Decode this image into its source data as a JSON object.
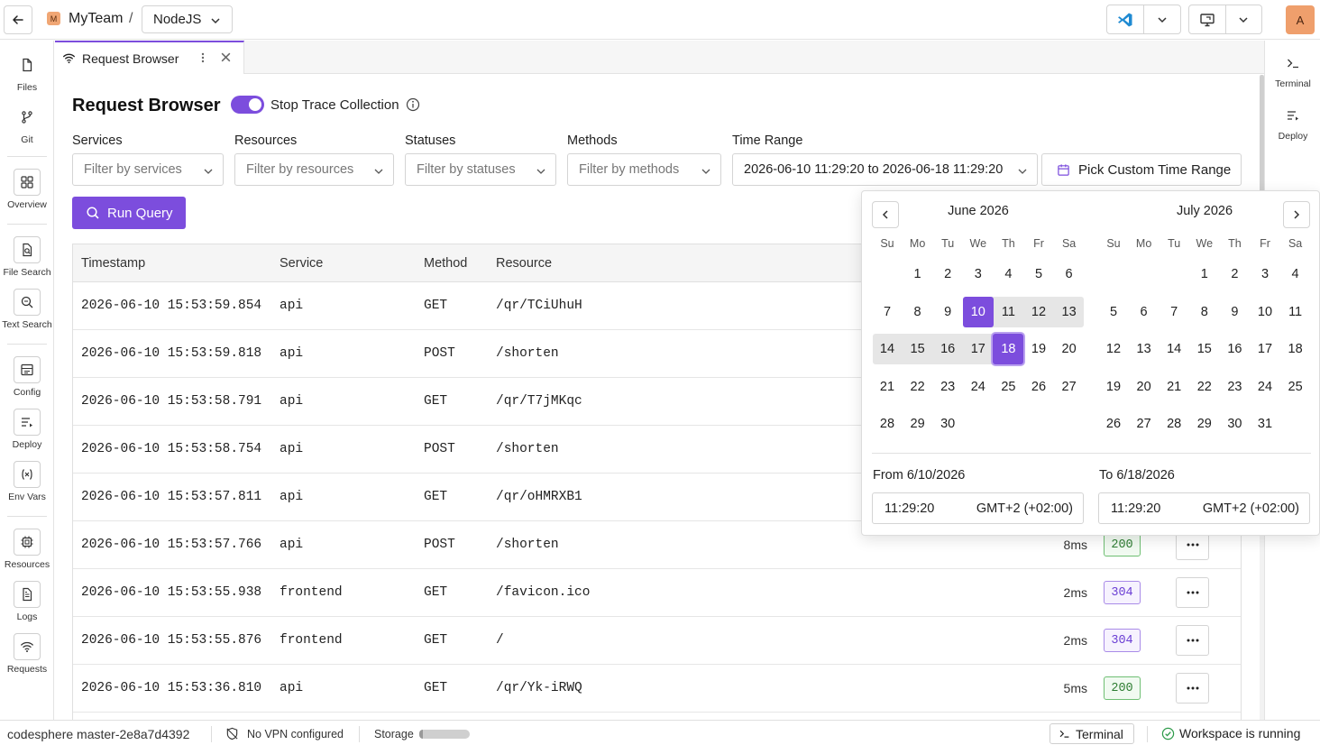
{
  "header": {
    "team_logo": "M",
    "team_name": "MyTeam",
    "separator": "/",
    "workspace": "NodeJS",
    "avatar": "A"
  },
  "sidebar": {
    "files": "Files",
    "git": "Git",
    "overview": "Overview",
    "file_search": "File Search",
    "text_search": "Text Search",
    "config": "Config",
    "deploy": "Deploy",
    "env_vars": "Env Vars",
    "resources": "Resources",
    "logs": "Logs",
    "requests": "Requests"
  },
  "right_sidebar": {
    "terminal": "Terminal",
    "deploy": "Deploy"
  },
  "tab": {
    "title": "Request Browser"
  },
  "page": {
    "title": "Request Browser",
    "toggle_label": "Stop Trace Collection",
    "toggle_on": true
  },
  "filters": {
    "services_label": "Services",
    "services_placeholder": "Filter by services",
    "resources_label": "Resources",
    "resources_placeholder": "Filter by resources",
    "statuses_label": "Statuses",
    "statuses_placeholder": "Filter by statuses",
    "methods_label": "Methods",
    "methods_placeholder": "Filter by methods",
    "time_range_label": "Time Range",
    "time_range_value": "2026-06-10 11:29:20 to 2026-06-18 11:29:20",
    "custom_range_button": "Pick Custom Time Range",
    "run_query": "Run Query"
  },
  "table": {
    "headers": {
      "timestamp": "Timestamp",
      "service": "Service",
      "method": "Method",
      "resource": "Resource"
    },
    "rows": [
      {
        "timestamp": "2026-06-10 15:53:59.854",
        "service": "api",
        "method": "GET",
        "resource": "/qr/TCiUhuH",
        "duration": "",
        "status": ""
      },
      {
        "timestamp": "2026-06-10 15:53:59.818",
        "service": "api",
        "method": "POST",
        "resource": "/shorten",
        "duration": "",
        "status": ""
      },
      {
        "timestamp": "2026-06-10 15:53:58.791",
        "service": "api",
        "method": "GET",
        "resource": "/qr/T7jMKqc",
        "duration": "",
        "status": ""
      },
      {
        "timestamp": "2026-06-10 15:53:58.754",
        "service": "api",
        "method": "POST",
        "resource": "/shorten",
        "duration": "",
        "status": ""
      },
      {
        "timestamp": "2026-06-10 15:53:57.811",
        "service": "api",
        "method": "GET",
        "resource": "/qr/oHMRXB1",
        "duration": "",
        "status": ""
      },
      {
        "timestamp": "2026-06-10 15:53:57.766",
        "service": "api",
        "method": "POST",
        "resource": "/shorten",
        "duration": "8ms",
        "status": "200"
      },
      {
        "timestamp": "2026-06-10 15:53:55.938",
        "service": "frontend",
        "method": "GET",
        "resource": "/favicon.ico",
        "duration": "2ms",
        "status": "304"
      },
      {
        "timestamp": "2026-06-10 15:53:55.876",
        "service": "frontend",
        "method": "GET",
        "resource": "/",
        "duration": "2ms",
        "status": "304"
      },
      {
        "timestamp": "2026-06-10 15:53:36.810",
        "service": "api",
        "method": "GET",
        "resource": "/qr/Yk-iRWQ",
        "duration": "5ms",
        "status": "200"
      }
    ]
  },
  "picker": {
    "weekdays": [
      "Su",
      "Mo",
      "Tu",
      "We",
      "Th",
      "Fr",
      "Sa"
    ],
    "left_month": "June 2026",
    "right_month": "July 2026",
    "left_first_weekday": 1,
    "left_days": 30,
    "right_first_weekday": 3,
    "right_days": 31,
    "range_start": 10,
    "range_end": 18,
    "from_label": "From 6/10/2026",
    "to_label": "To 6/18/2026",
    "from_time": "11:29:20",
    "from_tz": "GMT+2 (+02:00)",
    "to_time": "11:29:20",
    "to_tz": "GMT+2 (+02:00)"
  },
  "statusbar": {
    "branch": "codesphere master-2e8a7d4392",
    "vpn": "No VPN configured",
    "storage": "Storage",
    "terminal": "Terminal",
    "workspace_status": "Workspace is running"
  },
  "colors": {
    "accent": "#7c4ddd",
    "status_200_text": "#2e7d32",
    "status_200_border": "#6fbf73",
    "status_200_bg": "#f1faf1",
    "status_304_text": "#6b3fd4",
    "status_304_border": "#a98be8",
    "status_304_bg": "#f6f2fe"
  },
  "icons": {
    "back": "arrow-left-icon",
    "ide": "vscode-icon",
    "screen": "monitor-icon",
    "tab": "wifi-icon",
    "info": "info-circle-icon",
    "calendar": "calendar-icon",
    "search": "search-icon",
    "vpn": "shield-off-icon",
    "workspace_status": "check-circle-icon"
  }
}
